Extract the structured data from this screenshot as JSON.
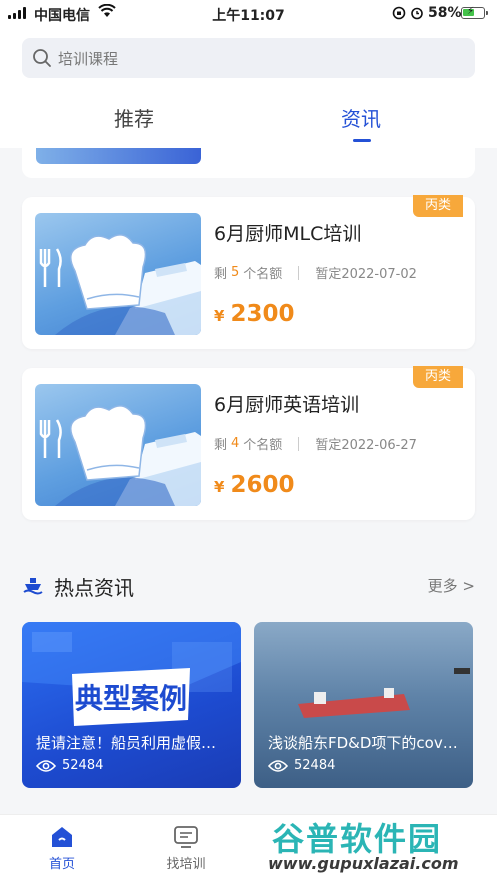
{
  "status_bar": {
    "carrier": "中国电信",
    "time": "上午11:07",
    "battery_percent": "58%",
    "battery_level": 0.58,
    "battery_color": "#44c24a"
  },
  "search": {
    "placeholder": "培训课程"
  },
  "tabs": [
    {
      "label": "推荐",
      "active": false
    },
    {
      "label": "资讯",
      "active": true
    }
  ],
  "courses": [
    {
      "badge": "丙类",
      "title": "6月厨师MLC培训",
      "remaining_prefix": "剩",
      "remaining": "5",
      "remaining_suffix": "个名额",
      "date": "暂定2022-07-02",
      "currency": "¥",
      "price": "2300"
    },
    {
      "badge": "丙类",
      "title": "6月厨师英语培训",
      "remaining_prefix": "剩",
      "remaining": "4",
      "remaining_suffix": "个名额",
      "date": "暂定2022-06-27",
      "currency": "¥",
      "price": "2600"
    }
  ],
  "hot_news": {
    "title": "热点资讯",
    "more": "更多 >",
    "items": [
      {
        "image_text": "典型案例",
        "caption": "提请注意！船员利用虚假…",
        "views": "52484"
      },
      {
        "caption": "浅谈船东FD&D项下的cov…",
        "views": "52484"
      }
    ]
  },
  "tabbar": [
    {
      "label": "首页",
      "icon": "home-icon",
      "active": true
    },
    {
      "label": "找培训",
      "icon": "message-icon",
      "active": false
    }
  ],
  "watermark": {
    "text": "谷普软件园",
    "url": "www.gupuxlazai.com"
  },
  "colors": {
    "accent": "#2451d6",
    "price": "#f08a1a",
    "badge": "#f7a83b"
  }
}
